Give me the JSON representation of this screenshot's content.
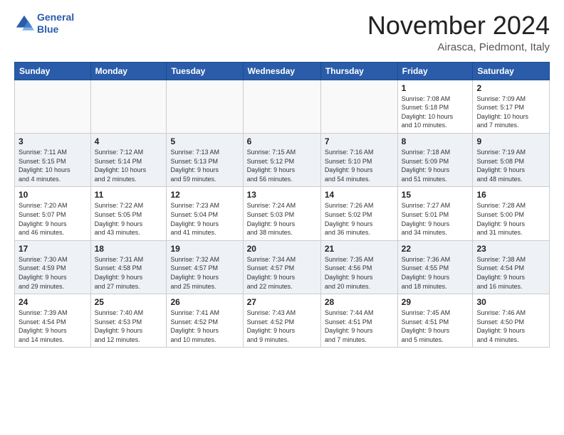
{
  "header": {
    "logo_line1": "General",
    "logo_line2": "Blue",
    "month": "November 2024",
    "location": "Airasca, Piedmont, Italy"
  },
  "weekdays": [
    "Sunday",
    "Monday",
    "Tuesday",
    "Wednesday",
    "Thursday",
    "Friday",
    "Saturday"
  ],
  "weeks": [
    [
      {
        "day": "",
        "info": ""
      },
      {
        "day": "",
        "info": ""
      },
      {
        "day": "",
        "info": ""
      },
      {
        "day": "",
        "info": ""
      },
      {
        "day": "",
        "info": ""
      },
      {
        "day": "1",
        "info": "Sunrise: 7:08 AM\nSunset: 5:18 PM\nDaylight: 10 hours\nand 10 minutes."
      },
      {
        "day": "2",
        "info": "Sunrise: 7:09 AM\nSunset: 5:17 PM\nDaylight: 10 hours\nand 7 minutes."
      }
    ],
    [
      {
        "day": "3",
        "info": "Sunrise: 7:11 AM\nSunset: 5:15 PM\nDaylight: 10 hours\nand 4 minutes."
      },
      {
        "day": "4",
        "info": "Sunrise: 7:12 AM\nSunset: 5:14 PM\nDaylight: 10 hours\nand 2 minutes."
      },
      {
        "day": "5",
        "info": "Sunrise: 7:13 AM\nSunset: 5:13 PM\nDaylight: 9 hours\nand 59 minutes."
      },
      {
        "day": "6",
        "info": "Sunrise: 7:15 AM\nSunset: 5:12 PM\nDaylight: 9 hours\nand 56 minutes."
      },
      {
        "day": "7",
        "info": "Sunrise: 7:16 AM\nSunset: 5:10 PM\nDaylight: 9 hours\nand 54 minutes."
      },
      {
        "day": "8",
        "info": "Sunrise: 7:18 AM\nSunset: 5:09 PM\nDaylight: 9 hours\nand 51 minutes."
      },
      {
        "day": "9",
        "info": "Sunrise: 7:19 AM\nSunset: 5:08 PM\nDaylight: 9 hours\nand 48 minutes."
      }
    ],
    [
      {
        "day": "10",
        "info": "Sunrise: 7:20 AM\nSunset: 5:07 PM\nDaylight: 9 hours\nand 46 minutes."
      },
      {
        "day": "11",
        "info": "Sunrise: 7:22 AM\nSunset: 5:05 PM\nDaylight: 9 hours\nand 43 minutes."
      },
      {
        "day": "12",
        "info": "Sunrise: 7:23 AM\nSunset: 5:04 PM\nDaylight: 9 hours\nand 41 minutes."
      },
      {
        "day": "13",
        "info": "Sunrise: 7:24 AM\nSunset: 5:03 PM\nDaylight: 9 hours\nand 38 minutes."
      },
      {
        "day": "14",
        "info": "Sunrise: 7:26 AM\nSunset: 5:02 PM\nDaylight: 9 hours\nand 36 minutes."
      },
      {
        "day": "15",
        "info": "Sunrise: 7:27 AM\nSunset: 5:01 PM\nDaylight: 9 hours\nand 34 minutes."
      },
      {
        "day": "16",
        "info": "Sunrise: 7:28 AM\nSunset: 5:00 PM\nDaylight: 9 hours\nand 31 minutes."
      }
    ],
    [
      {
        "day": "17",
        "info": "Sunrise: 7:30 AM\nSunset: 4:59 PM\nDaylight: 9 hours\nand 29 minutes."
      },
      {
        "day": "18",
        "info": "Sunrise: 7:31 AM\nSunset: 4:58 PM\nDaylight: 9 hours\nand 27 minutes."
      },
      {
        "day": "19",
        "info": "Sunrise: 7:32 AM\nSunset: 4:57 PM\nDaylight: 9 hours\nand 25 minutes."
      },
      {
        "day": "20",
        "info": "Sunrise: 7:34 AM\nSunset: 4:57 PM\nDaylight: 9 hours\nand 22 minutes."
      },
      {
        "day": "21",
        "info": "Sunrise: 7:35 AM\nSunset: 4:56 PM\nDaylight: 9 hours\nand 20 minutes."
      },
      {
        "day": "22",
        "info": "Sunrise: 7:36 AM\nSunset: 4:55 PM\nDaylight: 9 hours\nand 18 minutes."
      },
      {
        "day": "23",
        "info": "Sunrise: 7:38 AM\nSunset: 4:54 PM\nDaylight: 9 hours\nand 16 minutes."
      }
    ],
    [
      {
        "day": "24",
        "info": "Sunrise: 7:39 AM\nSunset: 4:54 PM\nDaylight: 9 hours\nand 14 minutes."
      },
      {
        "day": "25",
        "info": "Sunrise: 7:40 AM\nSunset: 4:53 PM\nDaylight: 9 hours\nand 12 minutes."
      },
      {
        "day": "26",
        "info": "Sunrise: 7:41 AM\nSunset: 4:52 PM\nDaylight: 9 hours\nand 10 minutes."
      },
      {
        "day": "27",
        "info": "Sunrise: 7:43 AM\nSunset: 4:52 PM\nDaylight: 9 hours\nand 9 minutes."
      },
      {
        "day": "28",
        "info": "Sunrise: 7:44 AM\nSunset: 4:51 PM\nDaylight: 9 hours\nand 7 minutes."
      },
      {
        "day": "29",
        "info": "Sunrise: 7:45 AM\nSunset: 4:51 PM\nDaylight: 9 hours\nand 5 minutes."
      },
      {
        "day": "30",
        "info": "Sunrise: 7:46 AM\nSunset: 4:50 PM\nDaylight: 9 hours\nand 4 minutes."
      }
    ]
  ]
}
